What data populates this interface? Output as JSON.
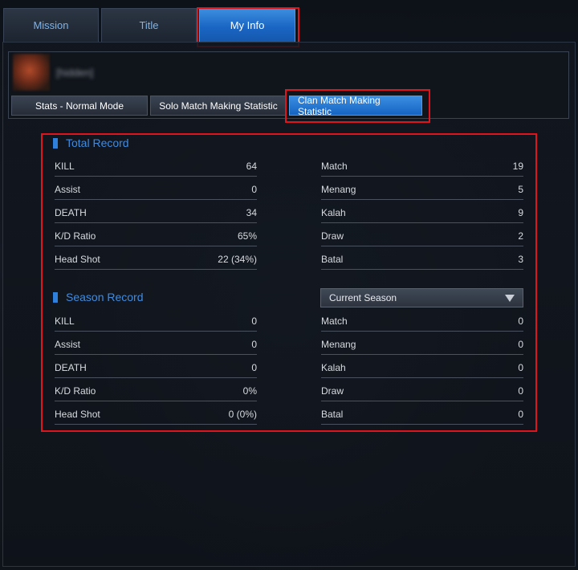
{
  "tabs": [
    {
      "label": "Mission"
    },
    {
      "label": "Title"
    },
    {
      "label": "My Info"
    }
  ],
  "profile": {
    "name": "[hidden]",
    "sub_tabs": [
      {
        "label": "Stats - Normal Mode"
      },
      {
        "label": "Solo Match Making Statistic"
      },
      {
        "label": "Clan Match Making Statistic"
      }
    ]
  },
  "total_record": {
    "title": "Total Record",
    "left": [
      {
        "label": "KILL",
        "value": "64"
      },
      {
        "label": "Assist",
        "value": "0"
      },
      {
        "label": "DEATH",
        "value": "34"
      },
      {
        "label": "K/D Ratio",
        "value": "65%"
      },
      {
        "label": "Head Shot",
        "value": "22 (34%)"
      }
    ],
    "right": [
      {
        "label": "Match",
        "value": "19"
      },
      {
        "label": "Menang",
        "value": "5"
      },
      {
        "label": "Kalah",
        "value": "9"
      },
      {
        "label": "Draw",
        "value": "2"
      },
      {
        "label": "Batal",
        "value": "3"
      }
    ]
  },
  "season_record": {
    "title": "Season Record",
    "season_select": "Current Season",
    "left": [
      {
        "label": "KILL",
        "value": "0"
      },
      {
        "label": "Assist",
        "value": "0"
      },
      {
        "label": "DEATH",
        "value": "0"
      },
      {
        "label": "K/D Ratio",
        "value": "0%"
      },
      {
        "label": "Head Shot",
        "value": "0 (0%)"
      }
    ],
    "right": [
      {
        "label": "Match",
        "value": "0"
      },
      {
        "label": "Menang",
        "value": "0"
      },
      {
        "label": "Kalah",
        "value": "0"
      },
      {
        "label": "Draw",
        "value": "0"
      },
      {
        "label": "Batal",
        "value": "0"
      }
    ]
  },
  "colors": {
    "accent_blue": "#1a66c4",
    "highlight_red": "#e0141c",
    "title_blue": "#3f8be0"
  }
}
